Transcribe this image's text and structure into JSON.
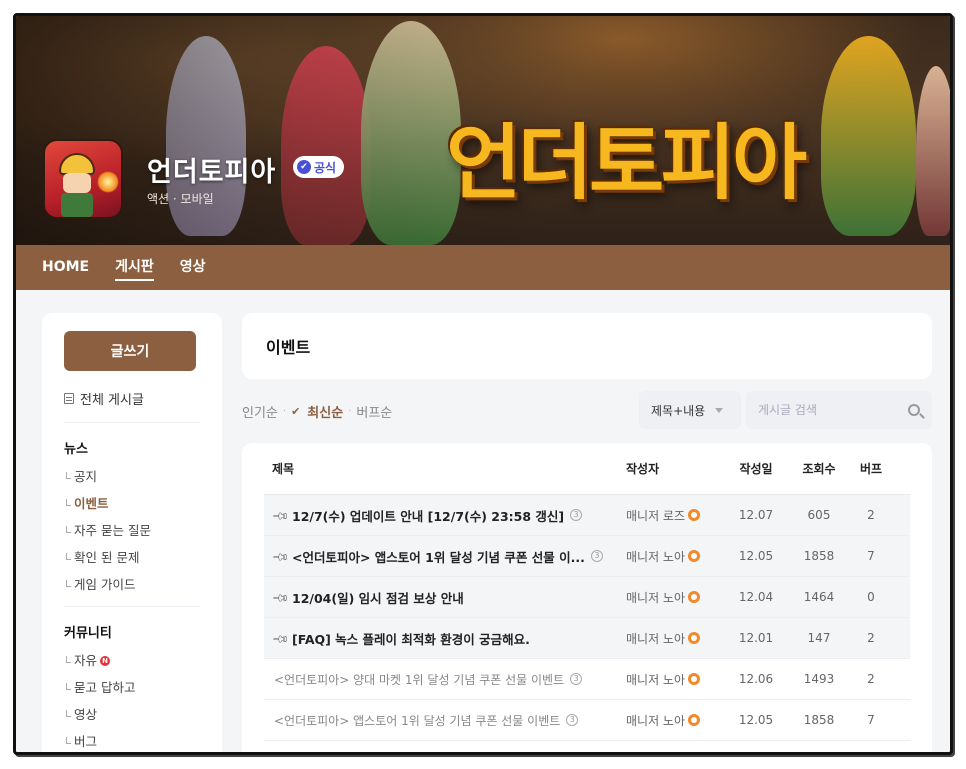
{
  "banner": {
    "logo_text": "언더토피아",
    "game_title": "언더토피아",
    "official_label": "공식",
    "genre": "액션 · 모바일"
  },
  "nav": {
    "items": [
      {
        "label": "HOME",
        "active": false
      },
      {
        "label": "게시판",
        "active": true
      },
      {
        "label": "영상",
        "active": false
      }
    ]
  },
  "sidebar": {
    "write_label": "글쓰기",
    "all_posts": "전체 게시글",
    "news_title": "뉴스",
    "news_items": [
      "공지",
      "이벤트",
      "자주 묻는 질문",
      "확인 된 문제",
      "게임 가이드"
    ],
    "community_title": "커뮤니티",
    "community_items": [
      "자유",
      "묻고 답하고",
      "영상",
      "버그"
    ],
    "new_badge": "N"
  },
  "board": {
    "title": "이벤트",
    "sort": [
      "인기순",
      "최신순",
      "버프순"
    ],
    "sort_active": "최신순",
    "search_type": "제목+내용",
    "search_placeholder": "게시글 검색"
  },
  "table": {
    "headers": {
      "title": "제목",
      "author": "작성자",
      "date": "작성일",
      "views": "조회수",
      "likes": "버프"
    },
    "rows": [
      {
        "pinned": true,
        "title": "12/7(수) 업데이트 안내 [12/7(수) 23:58 갱신]",
        "author": "매니저 로즈",
        "date": "12.07",
        "views": "605",
        "likes": "2"
      },
      {
        "pinned": true,
        "title": "<언더토피아> 앱스토어 1위 달성 기념 쿠폰 선물 이...",
        "author": "매니저 노아",
        "date": "12.05",
        "views": "1858",
        "likes": "7"
      },
      {
        "pinned": true,
        "title": "12/04(일) 임시 점검 보상 안내",
        "author": "매니저 노아",
        "date": "12.04",
        "views": "1464",
        "likes": "0"
      },
      {
        "pinned": true,
        "title": "[FAQ] 녹스 플레이 최적화 환경이 궁금해요.",
        "author": "매니저 노아",
        "date": "12.01",
        "views": "147",
        "likes": "2"
      },
      {
        "pinned": false,
        "title": "<언더토피아> 양대 마켓 1위 달성 기념 쿠폰 선물 이벤트",
        "author": "매니저 노아",
        "date": "12.06",
        "views": "1493",
        "likes": "2"
      },
      {
        "pinned": false,
        "title": "<언더토피아> 앱스토어 1위 달성 기념 쿠폰 선물 이벤트",
        "author": "매니저 노아",
        "date": "12.05",
        "views": "1858",
        "likes": "7"
      }
    ],
    "comment_icon_glyph": "3"
  },
  "colors": {
    "brand": "#8b5f3f",
    "badge": "#4a50d6",
    "staff": "#f08a2a",
    "new_dot": "#e5323a"
  }
}
